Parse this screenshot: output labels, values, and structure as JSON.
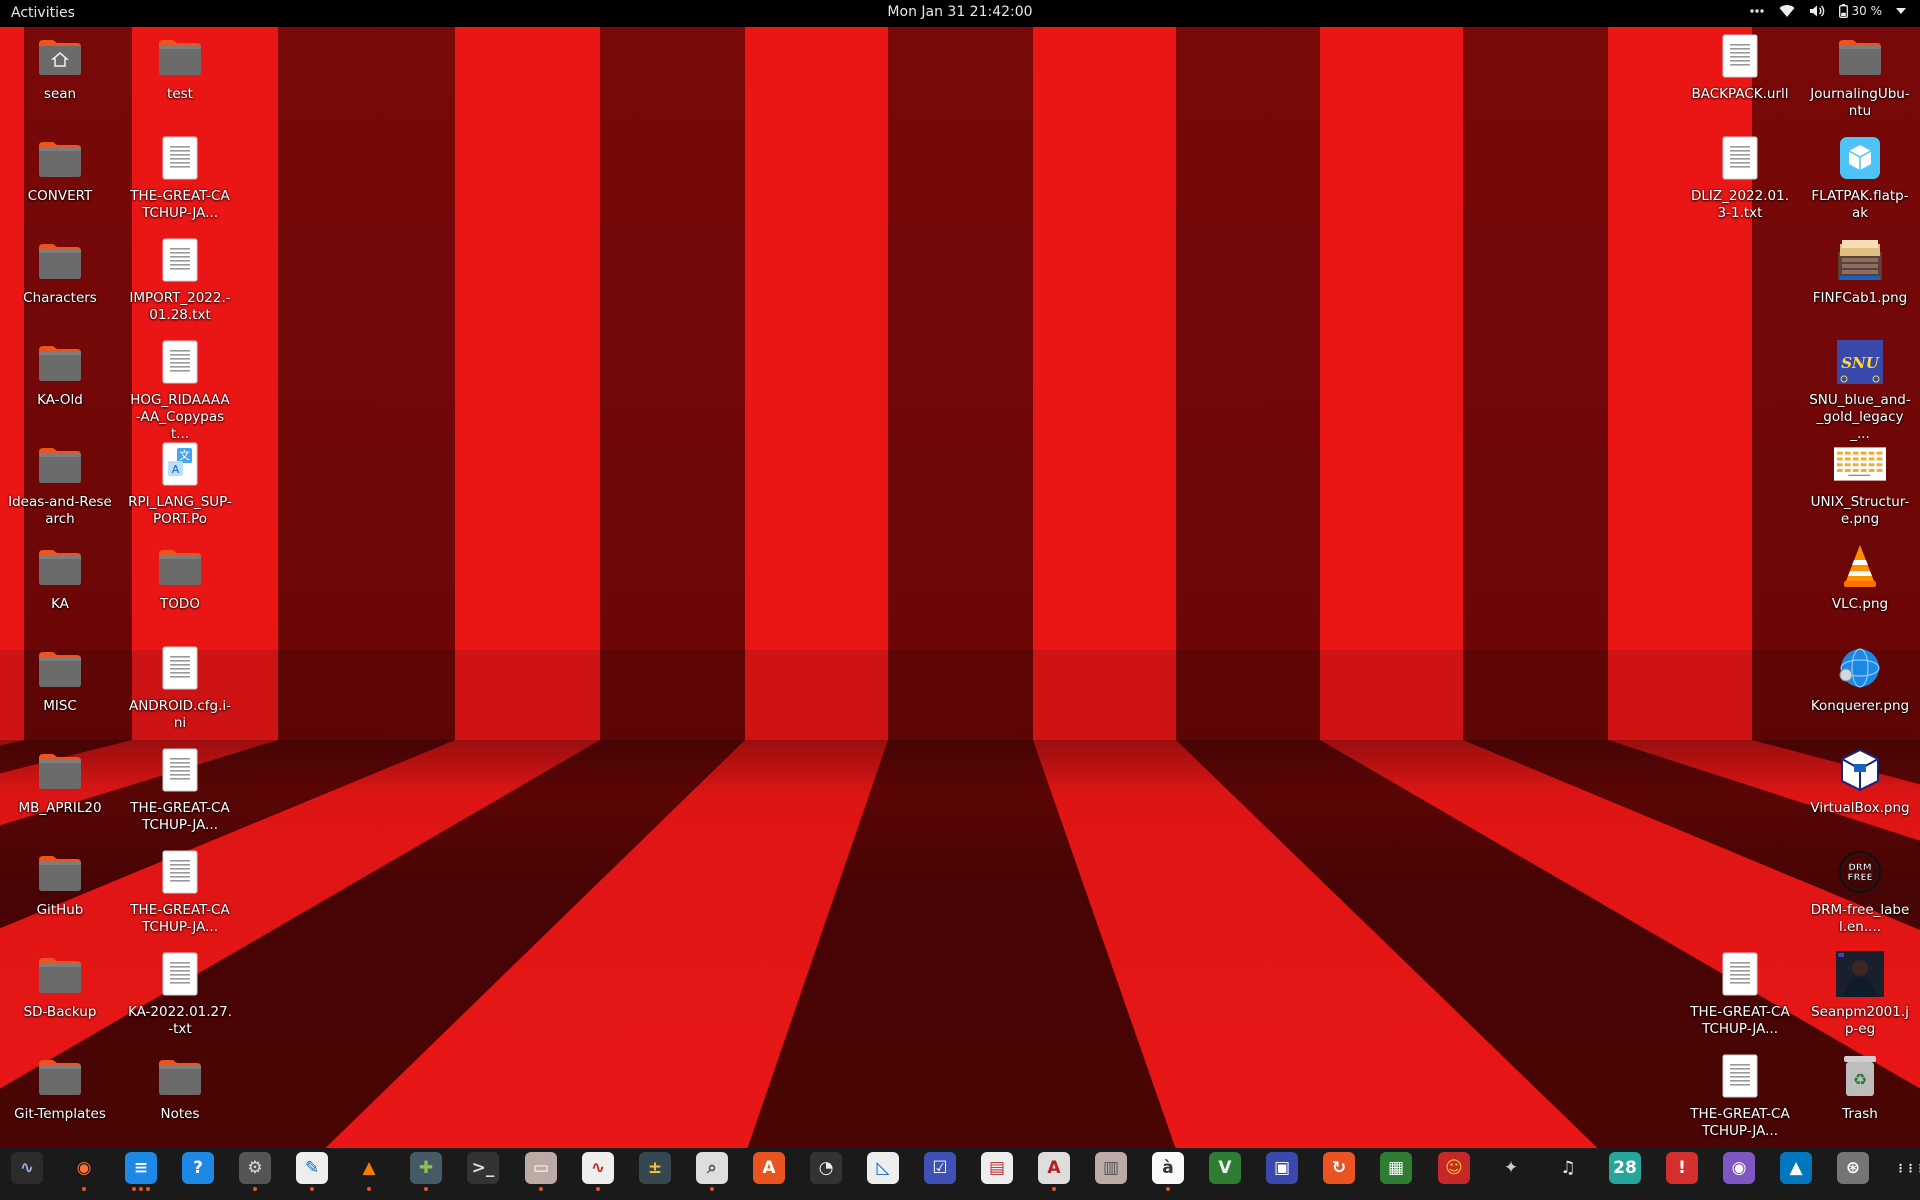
{
  "topbar": {
    "activities": "Activities",
    "clock": "Mon Jan 31  21:42:00",
    "battery": "30 %",
    "icons": [
      "overflow-dots-icon",
      "wifi-icon",
      "volume-icon",
      "battery-icon",
      "chevron-down-icon"
    ]
  },
  "desktop": {
    "left_col1": [
      {
        "name": "sean",
        "type": "home-folder"
      },
      {
        "name": "CONVERT",
        "type": "folder"
      },
      {
        "name": "Characters",
        "type": "folder"
      },
      {
        "name": "KA-Old",
        "type": "folder"
      },
      {
        "name": "Ideas-and-Research",
        "type": "folder"
      },
      {
        "name": "KA",
        "type": "folder"
      },
      {
        "name": "MISC",
        "type": "folder"
      },
      {
        "name": "MB_APRIL20",
        "type": "folder"
      },
      {
        "name": "GitHub",
        "type": "folder"
      },
      {
        "name": "SD-Backup",
        "type": "folder"
      },
      {
        "name": "Git-Templates",
        "type": "folder"
      }
    ],
    "left_col2": [
      {
        "name": "test",
        "type": "folder"
      },
      {
        "name": "THE-GREAT-CATCHUP-JA...",
        "type": "document"
      },
      {
        "name": "IMPORT_2022.-01.28.txt",
        "type": "document"
      },
      {
        "name": "HOG_RIDAAAA-AA_Copypast...",
        "type": "document"
      },
      {
        "name": "RPI_LANG_SUP-PORT.Po",
        "type": "translation"
      },
      {
        "name": "TODO",
        "type": "folder"
      },
      {
        "name": "ANDROID.cfg.i-ni",
        "type": "document"
      },
      {
        "name": "THE-GREAT-CATCHUP-JA...",
        "type": "document"
      },
      {
        "name": "THE-GREAT-CATCHUP-JA...",
        "type": "document"
      },
      {
        "name": "KA-2022.01.27.-txt",
        "type": "document"
      },
      {
        "name": "Notes",
        "type": "folder"
      }
    ],
    "right_col1": [
      {
        "name": "BACKPACK.urll",
        "type": "document",
        "row": 0
      },
      {
        "name": "DLIZ_2022.01.3-1.txt",
        "type": "document",
        "row": 1
      },
      {
        "name": "THE-GREAT-CATCHUP-JA...",
        "type": "document",
        "row": 9
      },
      {
        "name": "THE-GREAT-CATCHUP-JA...",
        "type": "document",
        "row": 10
      }
    ],
    "right_col2": [
      {
        "name": "JournalingUbu-ntu",
        "type": "folder"
      },
      {
        "name": "FLATPAK.flatp-ak",
        "type": "flatpak"
      },
      {
        "name": "FINFCab1.png",
        "type": "cabinet-image"
      },
      {
        "name": "SNU_blue_and-_gold_legacy_...",
        "type": "snu-image"
      },
      {
        "name": "UNIX_Structur-e.png",
        "type": "diagram-image"
      },
      {
        "name": "VLC.png",
        "type": "vlc-image"
      },
      {
        "name": "Konquerer.png",
        "type": "globe-image"
      },
      {
        "name": "VirtualBox.png",
        "type": "virtualbox-image"
      },
      {
        "name": "DRM-free_label.en....",
        "type": "drm-image"
      },
      {
        "name": "Seanpm2001.jp-eg",
        "type": "photo-image"
      },
      {
        "name": "Trash",
        "type": "trash"
      }
    ],
    "snu_text": "SNU",
    "drm_text": "DRM FREE"
  },
  "dock": {
    "items": [
      {
        "id": "system-monitor",
        "glyph": "∿",
        "bg": "#2c2c2c",
        "fg": "#9ad",
        "dots": 0
      },
      {
        "id": "firefox",
        "glyph": "◉",
        "bg": "#1a1a1a",
        "fg": "#ff7139",
        "dots": 1
      },
      {
        "id": "writer",
        "glyph": "≡",
        "bg": "#1e88e5",
        "fg": "#fff",
        "dots": 3
      },
      {
        "id": "help",
        "glyph": "?",
        "bg": "#1e88e5",
        "fg": "#fff",
        "dots": 0
      },
      {
        "id": "settings",
        "glyph": "⚙",
        "bg": "#555",
        "fg": "#ddd",
        "dots": 1
      },
      {
        "id": "text-editor",
        "glyph": "✎",
        "bg": "#eee",
        "fg": "#1565c0",
        "dots": 1
      },
      {
        "id": "vlc",
        "glyph": "▲",
        "bg": "#1a1a1a",
        "fg": "#f57c00",
        "dots": 1
      },
      {
        "id": "puzzle",
        "glyph": "✚",
        "bg": "#455a64",
        "fg": "#8bc34a",
        "dots": 1
      },
      {
        "id": "terminal",
        "glyph": ">_",
        "bg": "#333",
        "fg": "#ddd",
        "dots": 0
      },
      {
        "id": "files",
        "glyph": "▭",
        "bg": "#bcaaa4",
        "fg": "#fff",
        "dots": 1
      },
      {
        "id": "monitor-graph",
        "glyph": "∿",
        "bg": "#eee",
        "fg": "#c62828",
        "dots": 1
      },
      {
        "id": "calculator",
        "glyph": "±",
        "bg": "#37474f",
        "fg": "#fbc02d",
        "dots": 0
      },
      {
        "id": "image-viewer",
        "glyph": "⌕",
        "bg": "#ddd",
        "fg": "#555",
        "dots": 1
      },
      {
        "id": "app-store",
        "glyph": "A",
        "bg": "#e95420",
        "fg": "#fff",
        "dots": 0
      },
      {
        "id": "disk-usage",
        "glyph": "◔",
        "bg": "#333",
        "fg": "#eee",
        "dots": 0
      },
      {
        "id": "document-scanner",
        "glyph": "◺",
        "bg": "#eee",
        "fg": "#1565c0",
        "dots": 0
      },
      {
        "id": "todo",
        "glyph": "☑",
        "bg": "#3f51b5",
        "fg": "#fff",
        "dots": 0
      },
      {
        "id": "document-viewer",
        "glyph": "▤",
        "bg": "#eee",
        "fg": "#c62828",
        "dots": 0
      },
      {
        "id": "font-viewer",
        "glyph": "A",
        "bg": "#ddd",
        "fg": "#b71c1c",
        "dots": 1
      },
      {
        "id": "archive-manager",
        "glyph": "▥",
        "bg": "#bcaaa4",
        "fg": "#555",
        "dots": 0
      },
      {
        "id": "character-map",
        "glyph": "à",
        "bg": "#fafafa",
        "fg": "#333",
        "dots": 1
      },
      {
        "id": "vim",
        "glyph": "V",
        "bg": "#2e7d32",
        "fg": "#eee",
        "dots": 0
      },
      {
        "id": "remote-desktop",
        "glyph": "▣",
        "bg": "#3949ab",
        "fg": "#fff",
        "dots": 0
      },
      {
        "id": "software-updater",
        "glyph": "↻",
        "bg": "#e95420",
        "fg": "#fff",
        "dots": 0
      },
      {
        "id": "spreadsheet",
        "glyph": "▦",
        "bg": "#2e7d32",
        "fg": "#fff",
        "dots": 0
      },
      {
        "id": "game-character",
        "glyph": "☺",
        "bg": "#c62828",
        "fg": "#fbc02d",
        "dots": 0
      },
      {
        "id": "screenshot-tool",
        "glyph": "✦",
        "bg": "#1a1a1a",
        "fg": "#ccc",
        "dots": 0
      },
      {
        "id": "music",
        "glyph": "♫",
        "bg": "#1a1a1a",
        "fg": "#eee",
        "dots": 0
      },
      {
        "id": "calendar",
        "glyph": "28",
        "bg": "#26a69a",
        "fg": "#fff",
        "dots": 0
      },
      {
        "id": "error-reporter",
        "glyph": "!",
        "bg": "#d32f2f",
        "fg": "#fff",
        "dots": 0
      },
      {
        "id": "screen-recorder",
        "glyph": "◉",
        "bg": "#7e57c2",
        "fg": "#fff",
        "dots": 0
      },
      {
        "id": "lake-app",
        "glyph": "▲",
        "bg": "#0277bd",
        "fg": "#fff",
        "dots": 0
      },
      {
        "id": "updater-gear",
        "glyph": "⊛",
        "bg": "#757575",
        "fg": "#fff",
        "dots": 0
      },
      {
        "id": "show-apps",
        "glyph": "⋮⋮⋮",
        "bg": "#1a1a1a",
        "fg": "#eee",
        "dots": 0
      }
    ]
  },
  "colors": {
    "stripe_light": "#ea1616",
    "stripe_dark": "#7a0909",
    "floor_shadow": "#4a0404",
    "folder": "#6b6b6b",
    "folder_tab": "#e95420",
    "topbar": "#000000",
    "dock": "#1a1a1a"
  }
}
